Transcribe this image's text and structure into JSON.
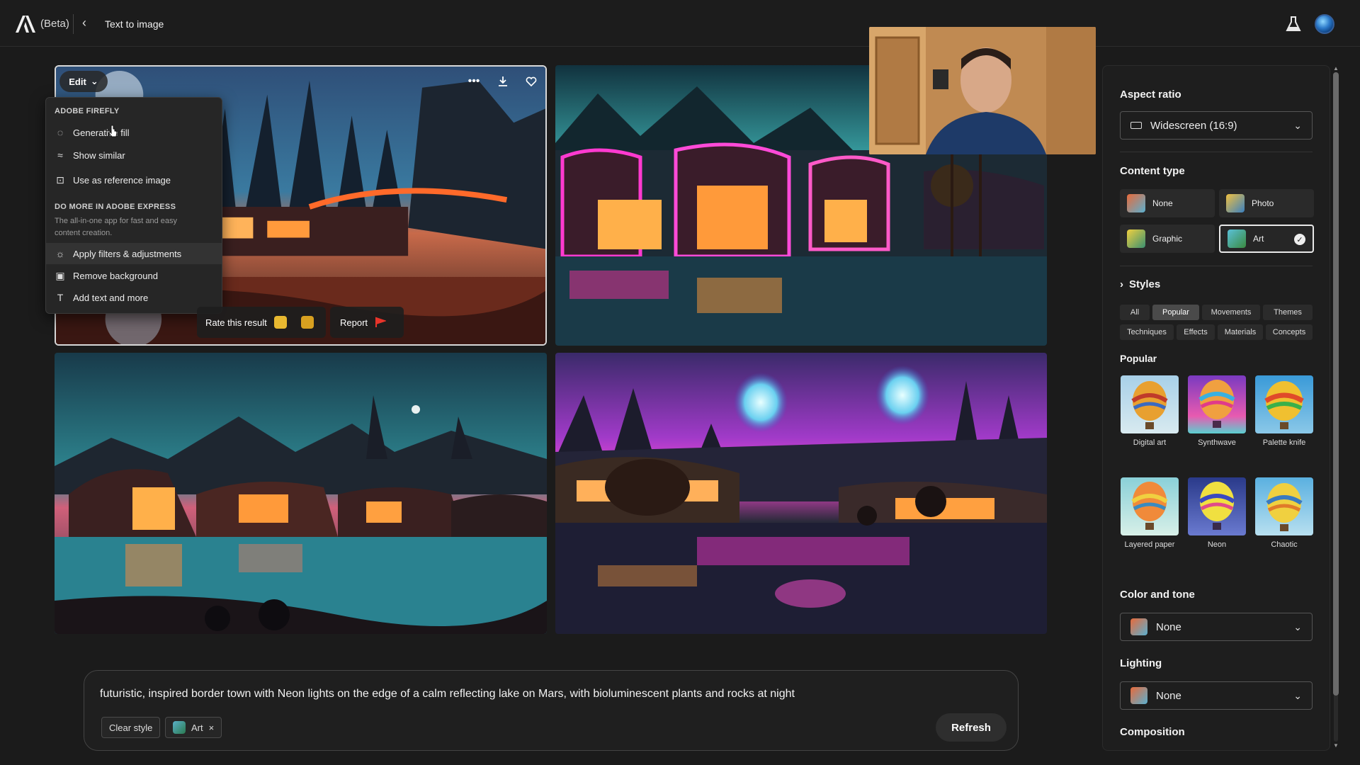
{
  "topbar": {
    "beta_label": "(Beta)",
    "breadcrumb": "Text to image"
  },
  "image_menu": {
    "edit_label": "Edit",
    "section1_title": "ADOBE FIREFLY",
    "items1": [
      "Generative fill",
      "Show similar",
      "Use as reference image"
    ],
    "section2_title": "DO MORE IN ADOBE EXPRESS",
    "section2_desc": "The all-in-one app for fast and easy content creation.",
    "items2": [
      "Apply filters & adjustments",
      "Remove background",
      "Add text and more"
    ]
  },
  "feedback": {
    "rate_label": "Rate this result",
    "report_label": "Report"
  },
  "prompt": {
    "text": "futuristic, inspired border town with Neon lights on the edge of a calm reflecting lake on Mars, with bioluminescent plants and rocks at night",
    "clear_style_label": "Clear style",
    "chip_label": "Art",
    "refresh_label": "Refresh"
  },
  "panel": {
    "aspect_ratio": {
      "title": "Aspect ratio",
      "value": "Widescreen (16:9)"
    },
    "content_type": {
      "title": "Content type",
      "options": [
        "None",
        "Photo",
        "Graphic",
        "Art"
      ],
      "selected": "Art"
    },
    "styles": {
      "title": "Styles",
      "tabs": [
        "All",
        "Popular",
        "Movements",
        "Themes",
        "Techniques",
        "Effects",
        "Materials",
        "Concepts"
      ],
      "active_tab": "Popular",
      "section_title": "Popular",
      "items": [
        "Digital art",
        "Synthwave",
        "Palette knife",
        "Layered paper",
        "Neon",
        "Chaotic"
      ]
    },
    "color_tone": {
      "title": "Color and tone",
      "value": "None"
    },
    "lighting": {
      "title": "Lighting",
      "value": "None"
    },
    "composition": {
      "title": "Composition"
    }
  },
  "colors": {
    "accent_selected_border": "#e8e8e8",
    "panel_bg": "#1e1e1e",
    "page_bg": "#1b1b1b"
  },
  "icons": [
    "adobe-logo-icon",
    "chevron-left-icon",
    "more-icon",
    "download-icon",
    "heart-icon",
    "thumbs-up-icon",
    "thumbs-down-icon",
    "flag-icon",
    "chevron-down-icon",
    "check-icon",
    "labs-flask-icon"
  ]
}
